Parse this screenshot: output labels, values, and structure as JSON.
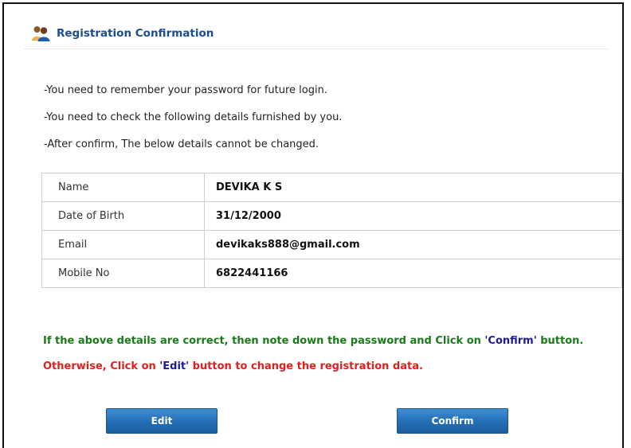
{
  "header": {
    "title": "Registration Confirmation",
    "icon": "users-icon"
  },
  "notes": [
    "-You need to remember your password for future login.",
    "-You need to check the following details furnished by you.",
    "-After confirm, The below details cannot be changed."
  ],
  "details": [
    {
      "label": "Name",
      "value": "DEVIKA K S"
    },
    {
      "label": "Date of Birth",
      "value": "31/12/2000"
    },
    {
      "label": "Email",
      "value": "devikaks888@gmail.com"
    },
    {
      "label": "Mobile No",
      "value": "6822441166"
    }
  ],
  "messages": {
    "confirm_prefix": "If the above details are correct, then note down the password and Click on ",
    "confirm_quoted": "'Confirm'",
    "confirm_suffix": " button.",
    "edit_prefix": "Otherwise, Click on ",
    "edit_quoted": "'Edit'",
    "edit_suffix": " button to change the registration data."
  },
  "buttons": {
    "edit": "Edit",
    "confirm": "Confirm"
  },
  "colors": {
    "title": "#1a4d8f",
    "success_text": "#197a19",
    "error_text": "#e02020",
    "quoted_text": "#1a1a99",
    "button": "#236db5"
  }
}
